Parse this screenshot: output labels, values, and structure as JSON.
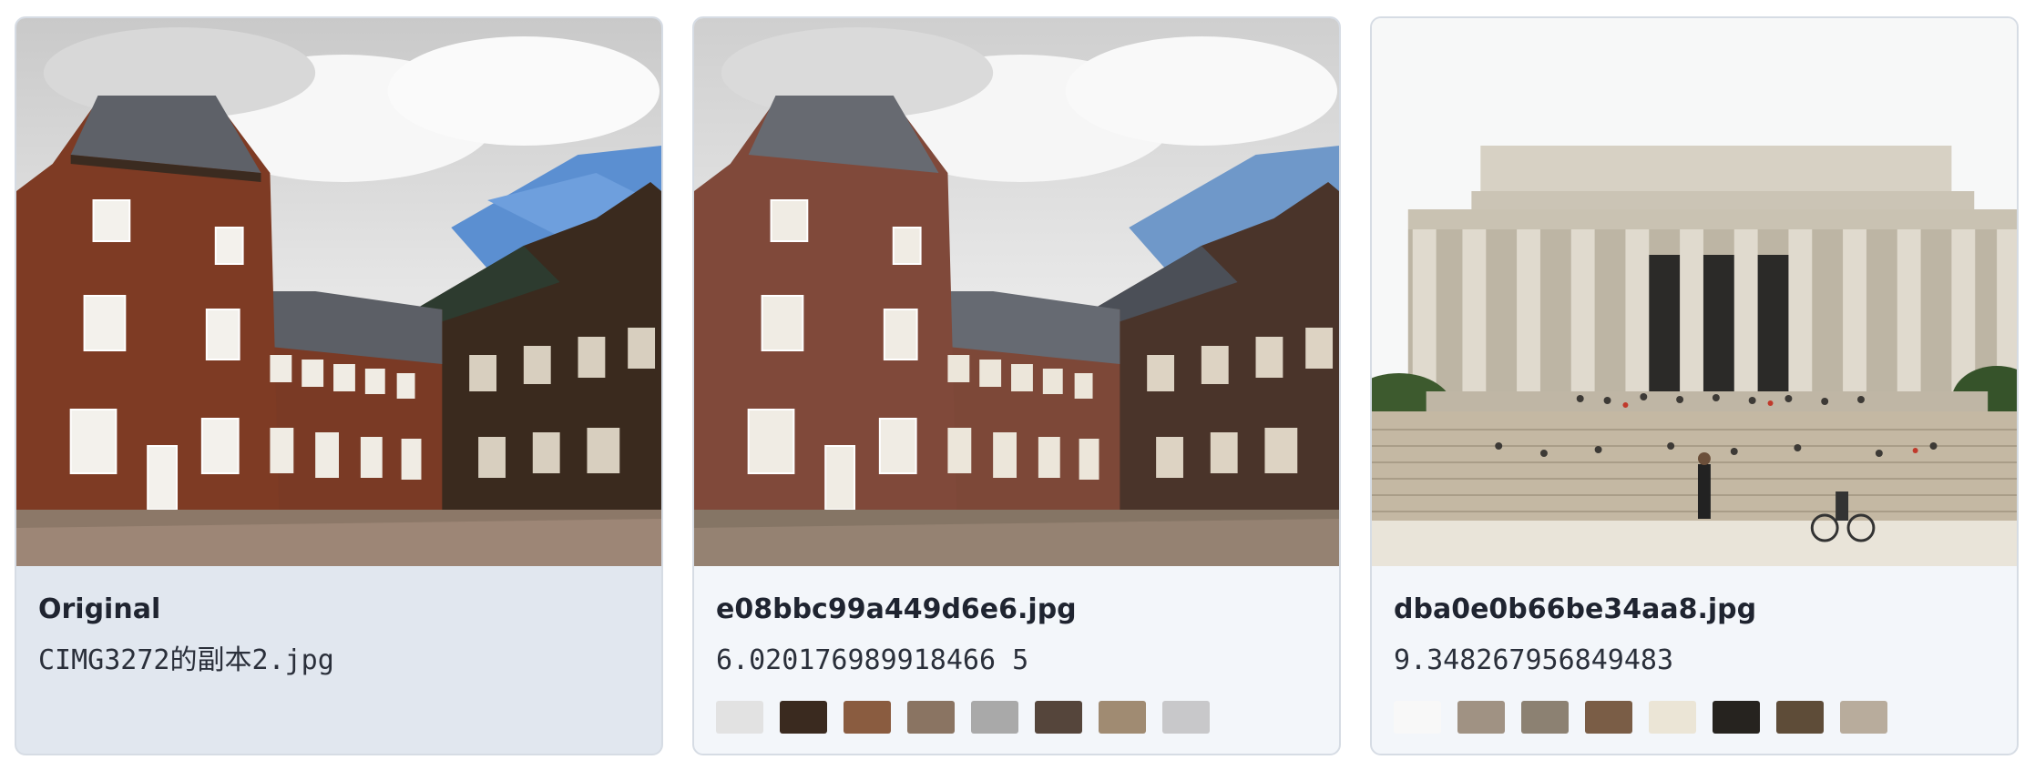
{
  "cards": [
    {
      "title": "Original",
      "subtitle": "CIMG3272的副本2.jpg",
      "image": "castle-photo",
      "swatches": []
    },
    {
      "title": "e08bbc99a449d6e6.jpg",
      "subtitle": "6.020176989918466 5",
      "image": "castle-photo",
      "swatches": [
        "#e2e2e2",
        "#3a2a1f",
        "#8a5c40",
        "#8a7462",
        "#a9a9a9",
        "#55453b",
        "#a08b72",
        "#c8c8ca"
      ]
    },
    {
      "title": "dba0e0b66be34aa8.jpg",
      "subtitle": "9.348267956849483",
      "image": "memorial-photo",
      "swatches": [
        "#f8f8f8",
        "#a09283",
        "#8c8172",
        "#7a5d46",
        "#ebe5d6",
        "#26231f",
        "#5e4c38",
        "#b8ac9c"
      ]
    }
  ]
}
